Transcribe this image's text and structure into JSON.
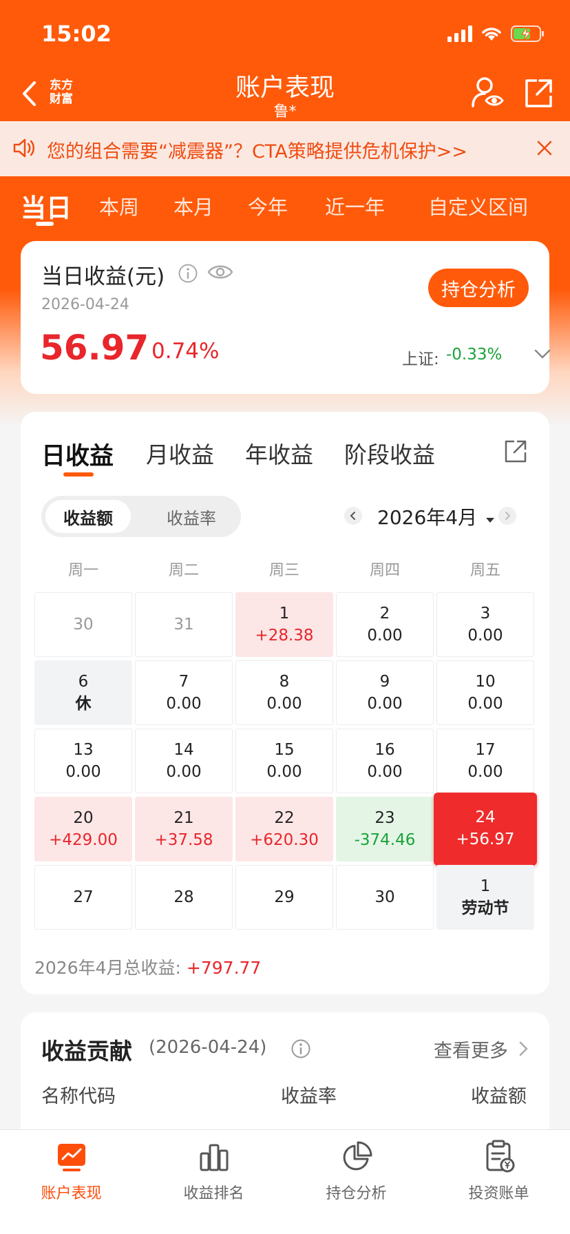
{
  "status_bar": {
    "time": "15:02"
  },
  "nav": {
    "logo_text": "东方财富",
    "title": "账户表现",
    "subtitle": "鲁*"
  },
  "notice": {
    "text": "您的组合需要“减震器”？CTA策略提供危机保护>>"
  },
  "period_tabs": [
    "当日",
    "本周",
    "本月",
    "今年",
    "近一年",
    "自定义区间"
  ],
  "summary": {
    "title": "当日收益(元)",
    "date": "2026-04-24",
    "value": "56.97",
    "percent": "0.74%",
    "holdings_button": "持仓分析",
    "index_label": "上证:",
    "index_value": "-0.33%"
  },
  "calendar": {
    "tabs": [
      "日收益",
      "月收益",
      "年收益",
      "阶段收益"
    ],
    "toggle": [
      "收益额",
      "收益率"
    ],
    "month": "2026年4月",
    "weekdays": [
      "周一",
      "周二",
      "周三",
      "周四",
      "周五"
    ],
    "rows": [
      [
        {
          "day": "30",
          "value": "",
          "type": "muted"
        },
        {
          "day": "31",
          "value": "",
          "type": "muted"
        },
        {
          "day": "1",
          "value": "+28.38",
          "type": "gain"
        },
        {
          "day": "2",
          "value": "0.00",
          "type": "normal"
        },
        {
          "day": "3",
          "value": "0.00",
          "type": "normal"
        }
      ],
      [
        {
          "day": "6",
          "value": "休",
          "type": "rest"
        },
        {
          "day": "7",
          "value": "0.00",
          "type": "normal"
        },
        {
          "day": "8",
          "value": "0.00",
          "type": "normal"
        },
        {
          "day": "9",
          "value": "0.00",
          "type": "normal"
        },
        {
          "day": "10",
          "value": "0.00",
          "type": "normal"
        }
      ],
      [
        {
          "day": "13",
          "value": "0.00",
          "type": "normal"
        },
        {
          "day": "14",
          "value": "0.00",
          "type": "normal"
        },
        {
          "day": "15",
          "value": "0.00",
          "type": "normal"
        },
        {
          "day": "16",
          "value": "0.00",
          "type": "normal"
        },
        {
          "day": "17",
          "value": "0.00",
          "type": "normal"
        }
      ],
      [
        {
          "day": "20",
          "value": "+429.00",
          "type": "gain"
        },
        {
          "day": "21",
          "value": "+37.58",
          "type": "gain"
        },
        {
          "day": "22",
          "value": "+620.30",
          "type": "gain"
        },
        {
          "day": "23",
          "value": "-374.46",
          "type": "loss"
        },
        {
          "day": "24",
          "value": "+56.97",
          "type": "today"
        }
      ],
      [
        {
          "day": "27",
          "value": "",
          "type": "normal"
        },
        {
          "day": "28",
          "value": "",
          "type": "normal"
        },
        {
          "day": "29",
          "value": "",
          "type": "normal"
        },
        {
          "day": "30",
          "value": "",
          "type": "normal"
        },
        {
          "day": "1",
          "value": "劳动节",
          "type": "rest"
        }
      ]
    ],
    "total_label": "2026年4月总收益:",
    "total_value": "+797.77"
  },
  "contribution": {
    "title": "收益贡献",
    "date": "(2026-04-24)",
    "more": "查看更多",
    "columns": [
      "名称代码",
      "收益率",
      "收益额"
    ]
  },
  "tabbar": [
    {
      "label": "账户表现",
      "icon": "chart-trend-icon",
      "active": true
    },
    {
      "label": "收益排名",
      "icon": "bar-chart-icon",
      "active": false
    },
    {
      "label": "持仓分析",
      "icon": "pie-chart-icon",
      "active": false
    },
    {
      "label": "投资账单",
      "icon": "bill-icon",
      "active": false
    }
  ],
  "colors": {
    "brand": "#ff5a0a",
    "gain": "#e8262b",
    "loss": "#1aa33a"
  }
}
